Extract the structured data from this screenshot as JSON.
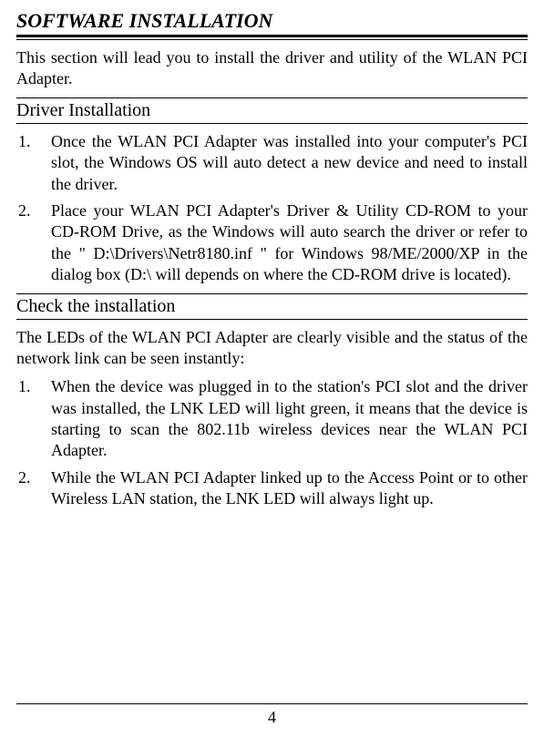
{
  "title": "SOFTWARE INSTALLATION",
  "intro": "This section will lead you to install the driver and utility of the WLAN PCI Adapter.",
  "section1": {
    "heading": "Driver Installation",
    "items": [
      {
        "num": "1.",
        "text": "Once the WLAN PCI Adapter was installed into your computer's PCI slot, the Windows OS will auto detect a new device and need to install the driver."
      },
      {
        "num": "2.",
        "text": "Place your WLAN PCI Adapter's Driver & Utility CD-ROM to your CD-ROM Drive, as the Windows will auto search the driver or refer to the \" D:\\Drivers\\Netr8180.inf \" for Windows 98/ME/2000/XP in the dialog box (D:\\ will depends on where the CD-ROM drive is located)."
      }
    ]
  },
  "section2": {
    "heading": "Check the installation",
    "body": "The LEDs of the WLAN PCI Adapter are clearly visible and the status of the network link can be seen instantly:",
    "items": [
      {
        "num": "1.",
        "text": "When the device was plugged in to the station's PCI slot and the driver was installed, the LNK LED will light green, it means that the device is starting to scan the 802.11b wireless devices near the WLAN PCI Adapter."
      },
      {
        "num": "2.",
        "text": "While the WLAN PCI Adapter linked up to the Access Point or to other Wireless LAN station, the LNK LED will always light up."
      }
    ]
  },
  "pageNumber": "4"
}
